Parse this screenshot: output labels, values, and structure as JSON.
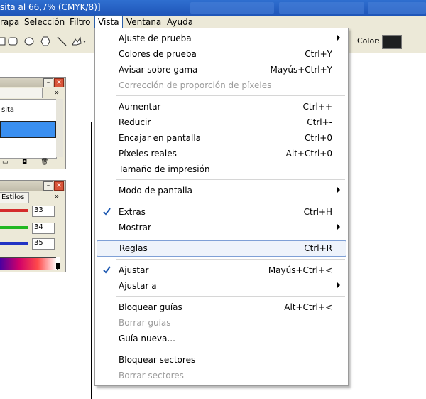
{
  "window": {
    "title": "sita al 66,7% (CMYK/8)]"
  },
  "menubar": {
    "items": [
      "rapa",
      "Selección",
      "Filtro",
      "Vista",
      "Ventana",
      "Ayuda"
    ],
    "open": "Vista"
  },
  "toolbar": {
    "color_label": "Color:",
    "color_value": "#1e2021"
  },
  "layers_panel": {
    "text": "sita"
  },
  "styles_panel": {
    "tab": "Estilos",
    "values": [
      "33",
      "34",
      "35"
    ],
    "slider_colors": [
      "#d42c2c",
      "#22b822",
      "#2233c4"
    ]
  },
  "vista_menu": {
    "items": [
      {
        "label": "Ajuste de prueba",
        "shortcut": "",
        "submenu": true
      },
      {
        "label": "Colores de prueba",
        "shortcut": "Ctrl+Y"
      },
      {
        "label": "Avisar sobre gama",
        "shortcut": "Mayús+Ctrl+Y"
      },
      {
        "label": "Corrección de proporción de píxeles",
        "shortcut": "",
        "disabled": true
      },
      {
        "label": "Aumentar",
        "shortcut": "Ctrl++"
      },
      {
        "label": "Reducir",
        "shortcut": "Ctrl+-"
      },
      {
        "label": "Encajar en pantalla",
        "shortcut": "Ctrl+0"
      },
      {
        "label": "Píxeles reales",
        "shortcut": "Alt+Ctrl+0"
      },
      {
        "label": "Tamaño de impresión",
        "shortcut": ""
      },
      {
        "label": "Modo de pantalla",
        "shortcut": "",
        "submenu": true
      },
      {
        "label": "Extras",
        "shortcut": "Ctrl+H",
        "checked": true
      },
      {
        "label": "Mostrar",
        "shortcut": "",
        "submenu": true
      },
      {
        "label": "Reglas",
        "shortcut": "Ctrl+R",
        "highlighted": true
      },
      {
        "label": "Ajustar",
        "shortcut": "Mayús+Ctrl+<",
        "checked": true
      },
      {
        "label": "Ajustar a",
        "shortcut": "",
        "submenu": true
      },
      {
        "label": "Bloquear guías",
        "shortcut": "Alt+Ctrl+<"
      },
      {
        "label": "Borrar guías",
        "shortcut": "",
        "disabled": true
      },
      {
        "label": "Guía nueva...",
        "shortcut": ""
      },
      {
        "label": "Bloquear sectores",
        "shortcut": ""
      },
      {
        "label": "Borrar sectores",
        "shortcut": "",
        "disabled": true
      }
    ]
  }
}
